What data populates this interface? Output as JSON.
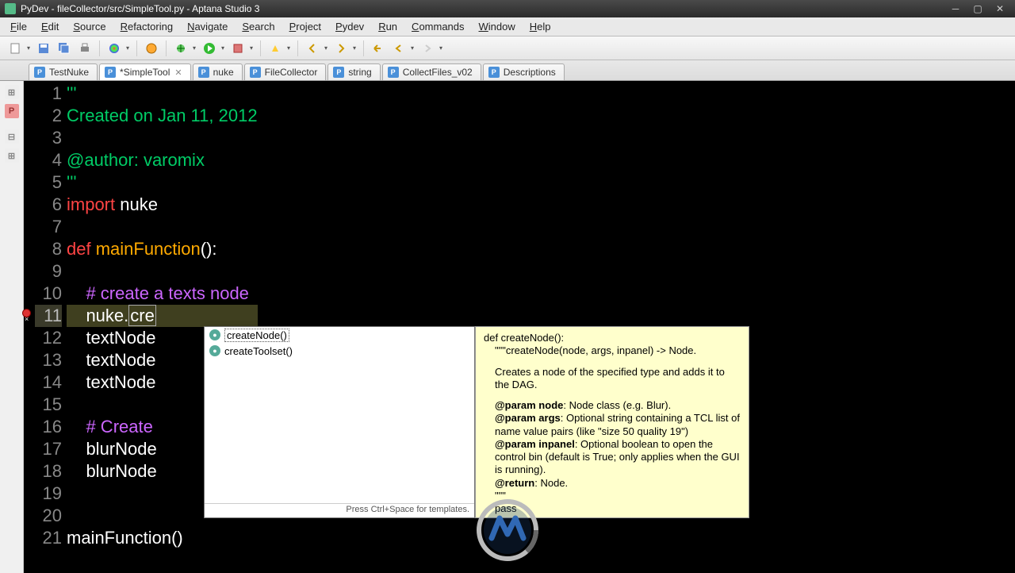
{
  "title": "PyDev - fileCollector/src/SimpleTool.py - Aptana Studio 3",
  "menu": [
    "File",
    "Edit",
    "Source",
    "Refactoring",
    "Navigate",
    "Search",
    "Project",
    "Pydev",
    "Run",
    "Commands",
    "Window",
    "Help"
  ],
  "tabs": [
    {
      "label": "TestNuke",
      "active": false,
      "dirty": false,
      "close": false
    },
    {
      "label": "*SimpleTool",
      "active": true,
      "dirty": true,
      "close": true
    },
    {
      "label": "nuke",
      "active": false,
      "dirty": false,
      "close": false
    },
    {
      "label": "FileCollector",
      "active": false,
      "dirty": false,
      "close": false
    },
    {
      "label": "string",
      "active": false,
      "dirty": false,
      "close": false
    },
    {
      "label": "CollectFiles_v02",
      "active": false,
      "dirty": false,
      "close": false
    },
    {
      "label": "Descriptions",
      "active": false,
      "dirty": false,
      "close": false
    }
  ],
  "code": {
    "lines": [
      {
        "n": 1,
        "segs": [
          {
            "cls": "c-docstr",
            "t": "'''"
          }
        ]
      },
      {
        "n": 2,
        "segs": [
          {
            "cls": "c-docstr",
            "t": "Created on Jan 11, 2012"
          }
        ]
      },
      {
        "n": 3,
        "segs": []
      },
      {
        "n": 4,
        "segs": [
          {
            "cls": "c-docstr",
            "t": "@author: varomix"
          }
        ]
      },
      {
        "n": 5,
        "segs": [
          {
            "cls": "c-docstr",
            "t": "'''"
          }
        ]
      },
      {
        "n": 6,
        "segs": [
          {
            "cls": "c-kw",
            "t": "import"
          },
          {
            "cls": "c-white",
            "t": " nuke"
          }
        ]
      },
      {
        "n": 7,
        "segs": []
      },
      {
        "n": 8,
        "segs": [
          {
            "cls": "c-kw",
            "t": "def "
          },
          {
            "cls": "c-fn",
            "t": "mainFunction"
          },
          {
            "cls": "c-white",
            "t": "():"
          }
        ]
      },
      {
        "n": 9,
        "segs": []
      },
      {
        "n": 10,
        "segs": [
          {
            "cls": "c-white",
            "t": "    "
          },
          {
            "cls": "c-hash",
            "t": "# create a texts node"
          }
        ]
      },
      {
        "n": 11,
        "hl": true,
        "err": true,
        "segs": [
          {
            "cls": "c-white",
            "t": "    nuke."
          },
          {
            "cls": "c-white caret-box",
            "t": "cre"
          }
        ]
      },
      {
        "n": 12,
        "segs": [
          {
            "cls": "c-white",
            "t": "    textNode"
          }
        ]
      },
      {
        "n": 13,
        "segs": [
          {
            "cls": "c-white",
            "t": "    textNode"
          }
        ]
      },
      {
        "n": 14,
        "segs": [
          {
            "cls": "c-white",
            "t": "    textNode"
          }
        ]
      },
      {
        "n": 15,
        "segs": []
      },
      {
        "n": 16,
        "segs": [
          {
            "cls": "c-white",
            "t": "    "
          },
          {
            "cls": "c-hash",
            "t": "# Create"
          }
        ]
      },
      {
        "n": 17,
        "segs": [
          {
            "cls": "c-white",
            "t": "    blurNode"
          }
        ]
      },
      {
        "n": 18,
        "segs": [
          {
            "cls": "c-white",
            "t": "    blurNode"
          }
        ]
      },
      {
        "n": 19,
        "segs": []
      },
      {
        "n": 20,
        "segs": []
      },
      {
        "n": 21,
        "segs": [
          {
            "cls": "c-white",
            "t": "mainFunction()"
          }
        ]
      }
    ]
  },
  "autocomplete": {
    "items": [
      {
        "label": "createNode()",
        "selected": true
      },
      {
        "label": "createToolset()",
        "selected": false
      }
    ],
    "footer": "Press Ctrl+Space for templates."
  },
  "doc": {
    "sig": "def createNode():",
    "summary": "\"\"\"createNode(node, args, inpanel) -> Node.",
    "desc": "Creates a node of the specified type and adds it to the DAG.",
    "params": [
      {
        "name": "@param node",
        "text": ": Node class (e.g. Blur)."
      },
      {
        "name": "@param args",
        "text": ": Optional string containing a TCL list of name value pairs (like \"size 50 quality 19\")"
      },
      {
        "name": "@param inpanel",
        "text": ": Optional boolean to open the control bin (default is True; only applies when the GUI is running)."
      },
      {
        "name": "@return",
        "text": ": Node."
      }
    ],
    "tail1": "\"\"\"",
    "tail2": "pass"
  }
}
